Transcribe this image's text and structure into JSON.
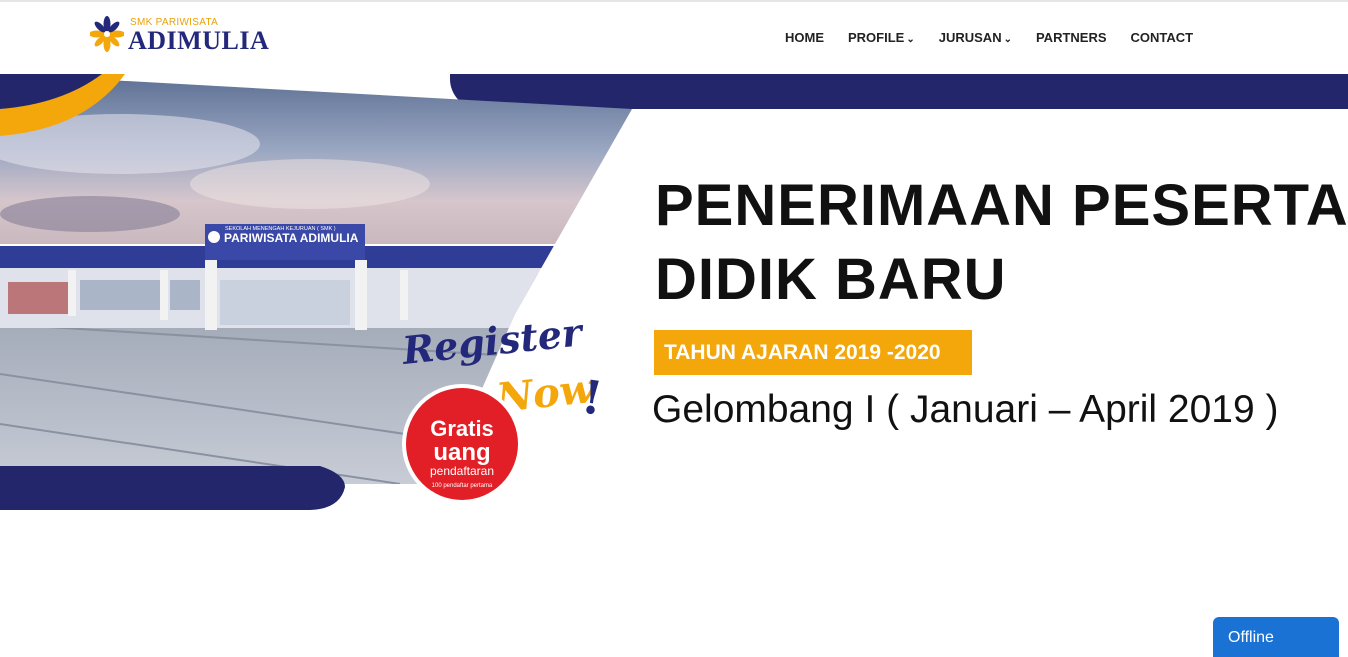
{
  "brand": {
    "sub": "SMK PARIWISATA",
    "name": "ADIMULIA"
  },
  "nav": {
    "items": [
      {
        "label": "HOME",
        "dropdown": false
      },
      {
        "label": "PROFILE",
        "dropdown": true
      },
      {
        "label": "JURUSAN",
        "dropdown": true
      },
      {
        "label": "PARTNERS",
        "dropdown": false
      },
      {
        "label": "CONTACT",
        "dropdown": false
      }
    ]
  },
  "hero": {
    "building_sign_small": "SEKOLAH MENENGAH KEJURUAN ( SMK )",
    "building_sign": "PARIWISATA ADIMULIA",
    "register_line1": "Register",
    "register_line2": "Now",
    "register_bang": "!",
    "gratis_line1": "Gratis",
    "gratis_line2": "uang",
    "gratis_line3": "pendaftaran",
    "gratis_note": "100 pendaftar pertama",
    "title_line1": "PENERIMAAN PESERTA",
    "title_line2": "DIDIK BARU",
    "year_badge": "TAHUN AJARAN 2019 -2020",
    "wave": "Gelombang I ( Januari – April 2019 )"
  },
  "chat": {
    "status": "Offline"
  },
  "colors": {
    "navy": "#23266b",
    "gold": "#f4a70b",
    "red": "#e21f26",
    "chat_blue": "#1a73d4"
  }
}
